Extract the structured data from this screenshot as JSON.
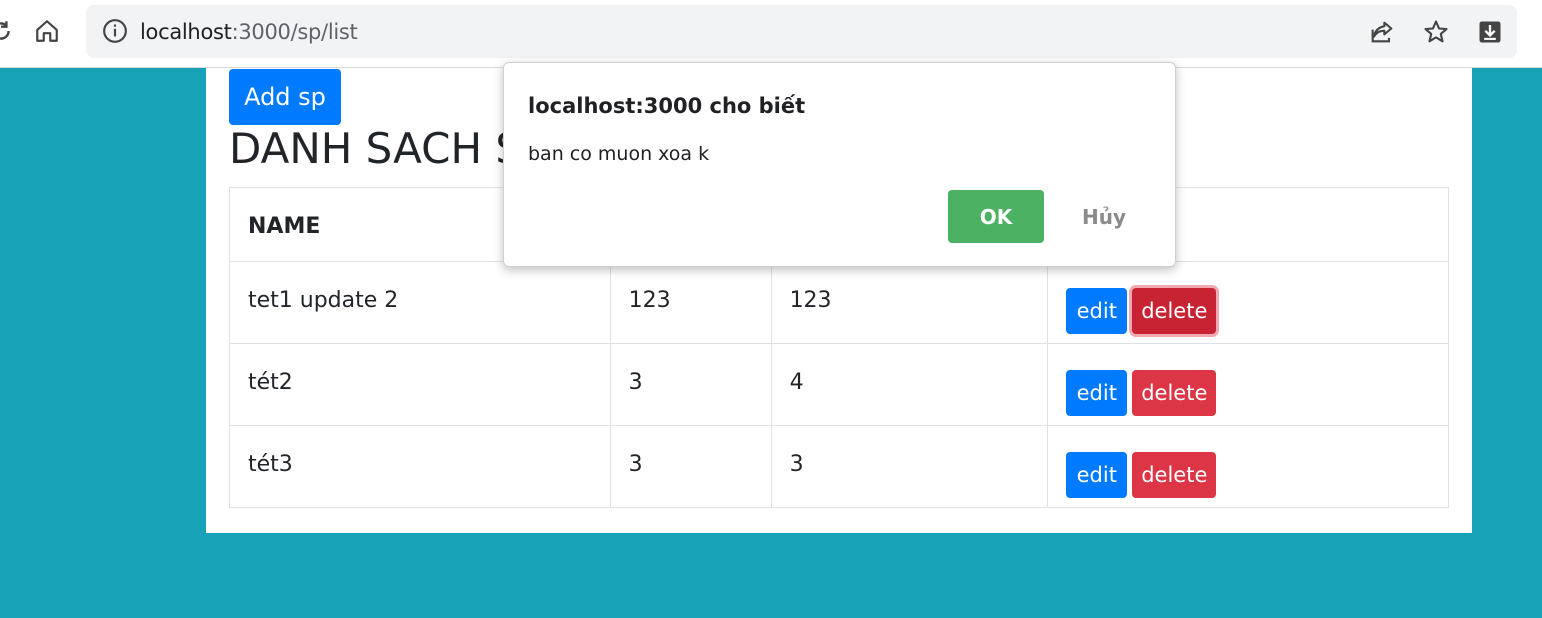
{
  "browser": {
    "url_host": "localhost",
    "url_path": ":3000/sp/list",
    "icons": [
      "reload-icon",
      "home-icon",
      "info-icon",
      "share-icon",
      "star-icon",
      "download-icon"
    ]
  },
  "page": {
    "add_button": "Add sp",
    "title": "DANH SACH SP",
    "table": {
      "headers": [
        "NAME",
        "",
        "",
        ""
      ],
      "rows": [
        {
          "name": "tet1 update 2",
          "col2": "123",
          "col3": "123"
        },
        {
          "name": "tét2",
          "col2": "3",
          "col3": "4"
        },
        {
          "name": "tét3",
          "col2": "3",
          "col3": "3"
        }
      ],
      "edit_label": "edit",
      "delete_label": "delete"
    }
  },
  "dialog": {
    "title": "localhost:3000 cho biết",
    "message": "ban co muon xoa k",
    "ok_label": "OK",
    "cancel_label": "Hủy"
  },
  "colors": {
    "page_background": "#17a2b8",
    "primary": "#007bff",
    "danger": "#dc3545",
    "ok_green": "#4cb163"
  }
}
